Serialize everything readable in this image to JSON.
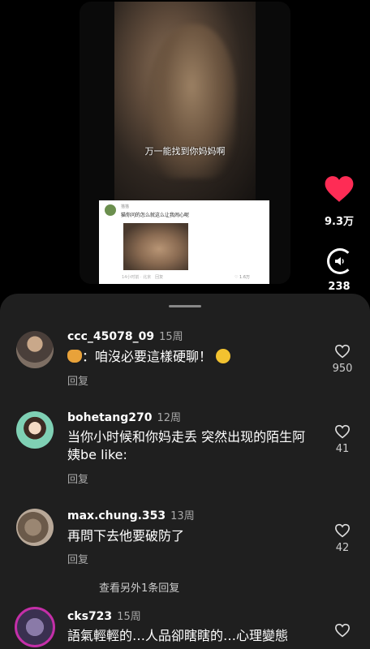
{
  "video": {
    "subtitle": "万一能找到你妈妈啊",
    "card": {
      "user": "猫猫",
      "text": "猫你问的怎么就这么让我闹心呢",
      "meta": "14小时前 · 北京",
      "reply": "回复",
      "likes": "1.6万"
    }
  },
  "actions": {
    "like_count": "9.3万",
    "sound_count": "238",
    "like_color": "#fe2c55"
  },
  "comments": [
    {
      "username": "ccc_45078_09",
      "time": "15周",
      "text": "：咱沒必要這樣硬聊！",
      "reply": "回复",
      "likes": "950"
    },
    {
      "username": "bohetang270",
      "time": "12周",
      "text": "当你小时候和你妈走丢 突然出现的陌生阿姨be like:",
      "reply": "回复",
      "likes": "41"
    },
    {
      "username": "max.chung.353",
      "time": "13周",
      "text": "再問下去他要破防了",
      "reply": "回复",
      "likes": "42"
    },
    {
      "username": "cks723",
      "time": "15周",
      "text": "語氣輕輕的…人品卻瞎瞎的…心理變態"
    }
  ],
  "view_more": "查看另外1条回复"
}
